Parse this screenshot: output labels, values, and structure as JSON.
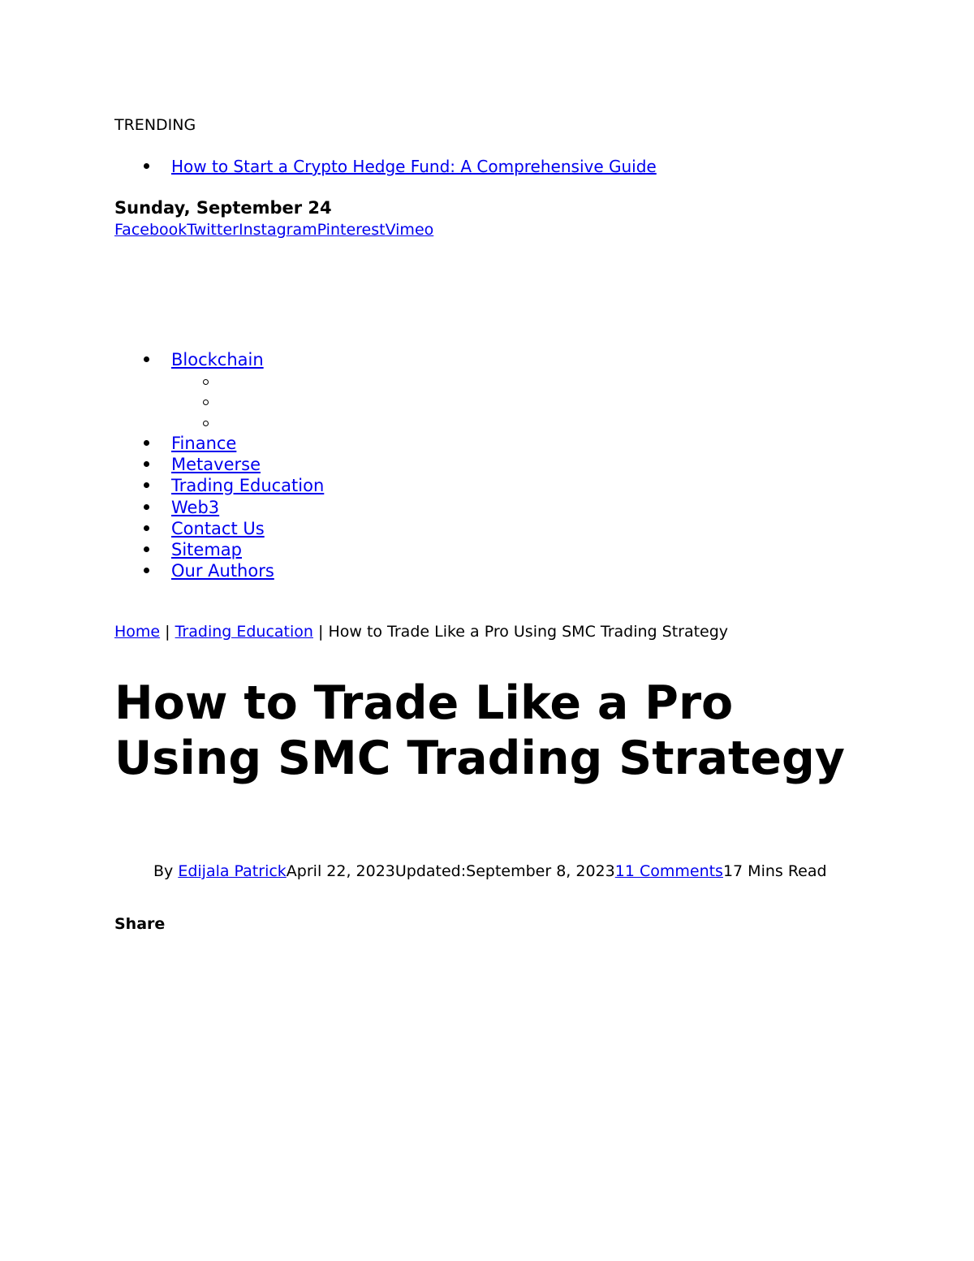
{
  "trending": {
    "label": "TRENDING",
    "items": [
      "How to Start a Crypto Hedge Fund: A Comprehensive Guide"
    ]
  },
  "date": "Sunday, September 24",
  "socials": [
    "Facebook",
    "Twitter",
    "Instagram",
    "Pinterest",
    "Vimeo"
  ],
  "nav": {
    "blockchain": "Blockchain",
    "items": [
      "Finance",
      "Metaverse",
      "Trading Education",
      "Web3",
      "Contact Us",
      "Sitemap",
      "Our Authors"
    ]
  },
  "breadcrumb": {
    "home": "Home",
    "separator": "|",
    "category": "Trading Education",
    "current": "How to Trade Like a Pro Using SMC Trading Strategy"
  },
  "article": {
    "title": "How to Trade Like a Pro Using SMC Trading Strategy",
    "by": "By",
    "author": "Edijala Patrick",
    "published": "April 22, 2023",
    "updated_label": "Updated:",
    "updated": "September 8, 2023",
    "comments": "11 Comments",
    "read_time": "17 Mins Read",
    "share_label": "Share"
  }
}
